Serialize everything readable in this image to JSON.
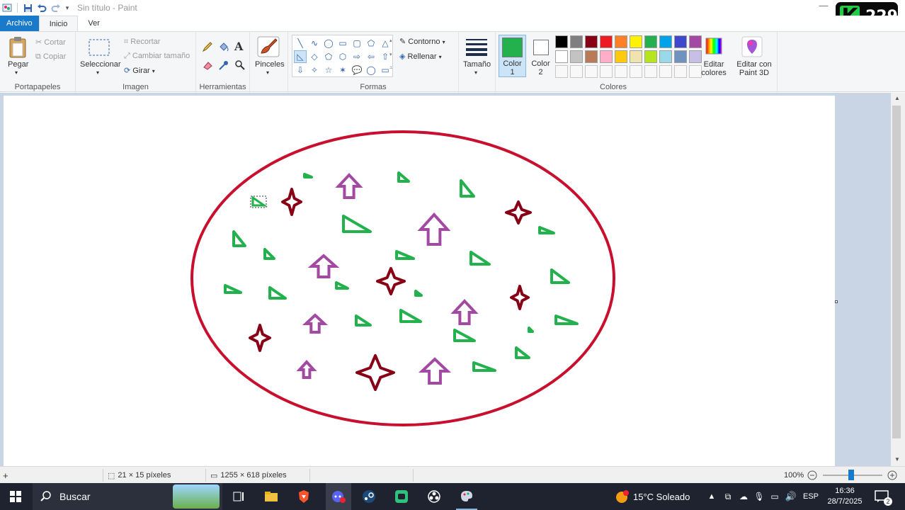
{
  "titlebar": {
    "title": "Sin título - Paint"
  },
  "badge": {
    "count": "229"
  },
  "tabs": [
    {
      "label": "Archivo"
    },
    {
      "label": "Inicio"
    },
    {
      "label": "Ver"
    }
  ],
  "clipboard": {
    "paste": "Pegar",
    "cut": "Cortar",
    "copy": "Copiar",
    "label": "Portapapeles"
  },
  "image": {
    "select": "Seleccionar",
    "crop": "Recortar",
    "resize": "Cambiar tamaño",
    "rotate": "Girar",
    "label": "Imagen"
  },
  "tools": {
    "label": "Herramientas"
  },
  "brushes": {
    "label": "Pinceles"
  },
  "shapes": {
    "outline": "Contorno",
    "fill": "Rellenar",
    "label": "Formas"
  },
  "size": {
    "label": "Tamaño"
  },
  "colors": {
    "color1": "Color",
    "color1_num": "1",
    "color2": "Color",
    "color2_num": "2",
    "edit": "Editar",
    "edit2": "colores",
    "paint3d": "Editar con",
    "paint3d2": "Paint 3D",
    "label": "Colores",
    "color1_value": "#22b14c",
    "color2_value": "#ffffff",
    "palette_row1": [
      "#000000",
      "#7f7f7f",
      "#880015",
      "#ed1c24",
      "#ff7f27",
      "#fff200",
      "#22b14c",
      "#00a2e8",
      "#3f48cc",
      "#a349a4"
    ],
    "palette_row2": [
      "#ffffff",
      "#c3c3c3",
      "#b97a57",
      "#ffaec9",
      "#ffc90e",
      "#efe4b0",
      "#b5e61d",
      "#99d9ea",
      "#7092be",
      "#c8bfe7"
    ]
  },
  "drawing": {
    "ellipse_color": "#c8102e",
    "triangle_color": "#22b14c",
    "arrow_color": "#a349a4",
    "star_color": "#880015"
  },
  "status": {
    "selection": "21 × 15 píxeles",
    "image_size": "1255 × 618 píxeles",
    "zoom": "100%"
  },
  "taskbar": {
    "search": "Buscar",
    "weather": "15°C  Soleado",
    "lang": "ESP",
    "time": "16:36",
    "date": "28/7/2025",
    "notif": "2",
    "weather_badge": "1"
  }
}
